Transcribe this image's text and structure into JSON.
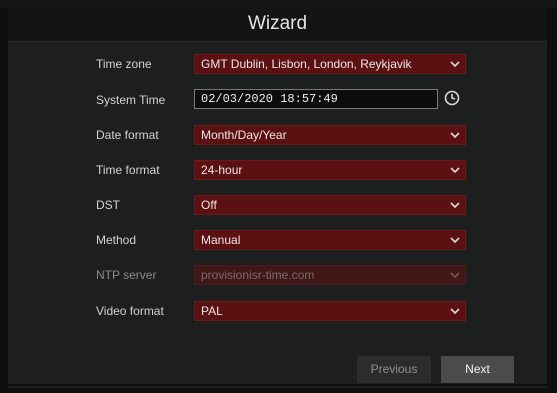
{
  "window": {
    "title": "Wizard"
  },
  "form": {
    "time_zone": {
      "label": "Time zone",
      "value": "GMT Dublin, Lisbon, London, Reykjavik"
    },
    "system_time": {
      "label": "System Time",
      "value": "02/03/2020 18:57:49"
    },
    "date_format": {
      "label": "Date format",
      "value": "Month/Day/Year"
    },
    "time_format": {
      "label": "Time format",
      "value": "24-hour"
    },
    "dst": {
      "label": "DST",
      "value": "Off"
    },
    "method": {
      "label": "Method",
      "value": "Manual"
    },
    "ntp_server": {
      "label": "NTP server",
      "value": "provisionisr-time.com"
    },
    "video_format": {
      "label": "Video format",
      "value": "PAL"
    }
  },
  "buttons": {
    "previous": "Previous",
    "next": "Next"
  },
  "colors": {
    "field_bg": "#5b1111",
    "window_bg": "#1d1e1e",
    "title_bg": "#131414"
  },
  "icons": {
    "dropdown": "chevron-down-icon",
    "clock": "clock-icon"
  }
}
